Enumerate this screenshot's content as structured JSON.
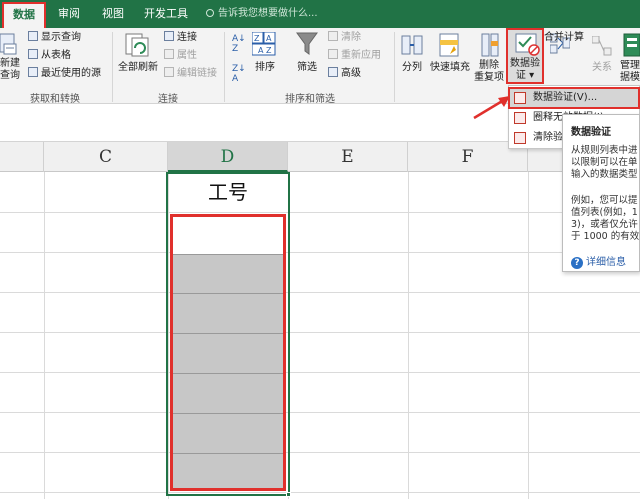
{
  "tabs": {
    "data": "数据",
    "review": "审阅",
    "view": "视图",
    "developer": "开发工具"
  },
  "tell_me": "告诉我您想要做什么...",
  "ribbon": {
    "get_transform": {
      "new_query": "新建\n查询",
      "show_queries": "显示查询",
      "from_table": "从表格",
      "recent_sources": "最近使用的源",
      "group_label": "获取和转换"
    },
    "connections": {
      "refresh_all": "全部刷新",
      "connections": "连接",
      "properties": "属性",
      "edit_links": "编辑链接",
      "group_label": "连接"
    },
    "sort_filter": {
      "sort": "排序",
      "filter": "筛选",
      "clear": "清除",
      "reapply": "重新应用",
      "advanced": "高级",
      "group_label": "排序和筛选"
    },
    "data_tools": {
      "text_to_columns": "分列",
      "flash_fill": "快速填充",
      "remove_duplicates": "删除\n重复项",
      "data_validation": "数据验\n证 ▾",
      "consolidate": "合并计算",
      "relationships": "关系",
      "manage_model": "管理\n据模"
    }
  },
  "columns": [
    "C",
    "D",
    "E",
    "F"
  ],
  "sheet": {
    "d_header": "工号"
  },
  "dropdown": {
    "items": [
      "数据验证(V)...",
      "圈释无效数据(I)",
      "清除验证标识圈(R)"
    ]
  },
  "tooltip": {
    "title": "数据验证",
    "body": [
      "从规则列表中进",
      "以限制可以在单",
      "输入的数据类型"
    ],
    "example": [
      "例如，您可以提",
      "值列表(例如，1",
      "3)，或者仅允许",
      "于 1000 的有效"
    ],
    "more": "详细信息"
  },
  "colors": {
    "excel_green": "#217346",
    "highlight_red": "#e0302c",
    "gray_fill": "#c7c7c7"
  }
}
